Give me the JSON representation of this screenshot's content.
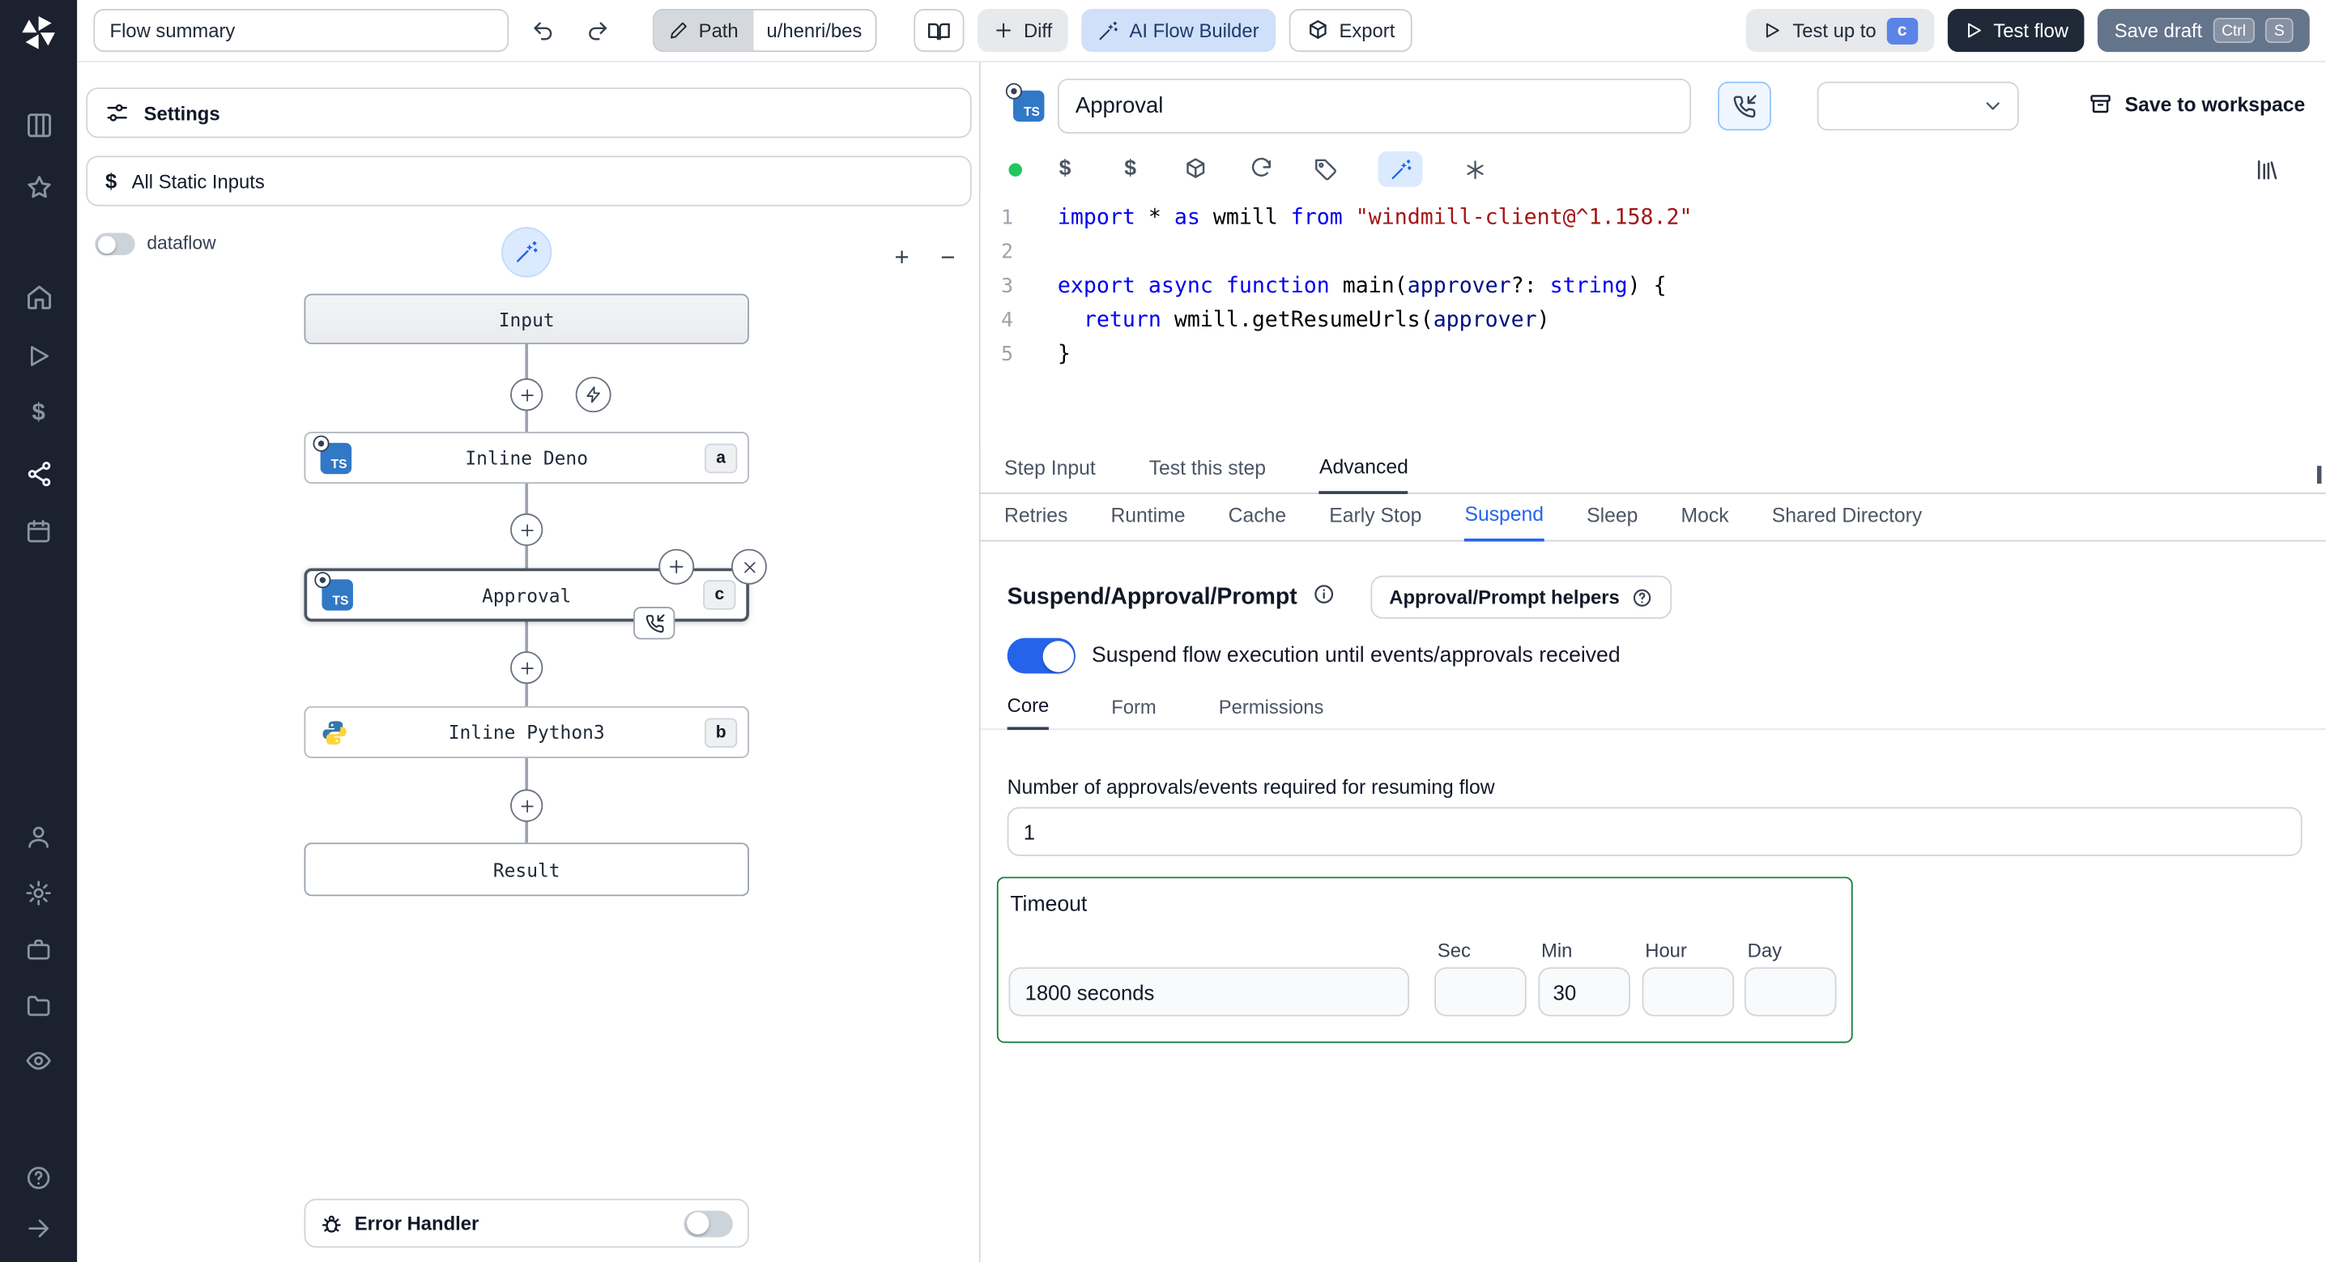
{
  "colors": {
    "accent_blue": "#2563eb",
    "light_blue": "#dbeafe",
    "dark_button": "#1f2937",
    "save_draft_button": "#64748b",
    "valid_dot_green": "#22c55e",
    "timeout_border_green": "#15803d",
    "sidebar_bg": "#1b212e",
    "ts_badge_blue": "#3178c6"
  },
  "icons": {
    "ts_label": "TS",
    "dollar_glyph": "$"
  },
  "topbar": {
    "summary_value": "Flow summary",
    "path_label": "Path",
    "path_value": "u/henri/bes",
    "diff_label": "Diff",
    "ai_builder_label": "AI Flow Builder",
    "export_label": "Export",
    "test_up_to_label": "Test up to",
    "test_up_to_badge": "c",
    "test_flow_label": "Test flow",
    "save_draft_label": "Save draft",
    "save_draft_kbd": [
      "Ctrl",
      "S"
    ]
  },
  "flow_panel": {
    "settings_label": "Settings",
    "static_inputs_label": "All Static Inputs",
    "dataflow_label": "dataflow",
    "zoom_in_label": "+",
    "zoom_out_label": "−",
    "nodes": {
      "input": {
        "label": "Input"
      },
      "deno": {
        "label": "Inline Deno",
        "badge": "a"
      },
      "approval": {
        "label": "Approval",
        "badge": "c"
      },
      "python": {
        "label": "Inline Python3",
        "badge": "b"
      },
      "result": {
        "label": "Result"
      }
    },
    "error_handler_label": "Error Handler"
  },
  "editor": {
    "step_name": "Approval",
    "save_to_workspace_label": "Save to workspace",
    "line_numbers": [
      "1",
      "2",
      "3",
      "4",
      "5"
    ],
    "code_lines": [
      [
        {
          "c": "k",
          "t": "import"
        },
        {
          "c": "p",
          "t": " * "
        },
        {
          "c": "k",
          "t": "as"
        },
        {
          "c": "p",
          "t": " wmill "
        },
        {
          "c": "k",
          "t": "from"
        },
        {
          "c": "p",
          "t": " "
        },
        {
          "c": "s",
          "t": "\"windmill-client@^1.158.2\""
        }
      ],
      [],
      [
        {
          "c": "k",
          "t": "export"
        },
        {
          "c": "p",
          "t": " "
        },
        {
          "c": "k",
          "t": "async"
        },
        {
          "c": "p",
          "t": " "
        },
        {
          "c": "k",
          "t": "function"
        },
        {
          "c": "p",
          "t": " "
        },
        {
          "c": "f",
          "t": "main"
        },
        {
          "c": "p",
          "t": "("
        },
        {
          "c": "v",
          "t": "approver"
        },
        {
          "c": "p",
          "t": "?: "
        },
        {
          "c": "k",
          "t": "string"
        },
        {
          "c": "p",
          "t": ") {"
        }
      ],
      [
        {
          "c": "p",
          "t": "  "
        },
        {
          "c": "k",
          "t": "return"
        },
        {
          "c": "p",
          "t": " wmill."
        },
        {
          "c": "f",
          "t": "getResumeUrls"
        },
        {
          "c": "p",
          "t": "("
        },
        {
          "c": "v",
          "t": "approver"
        },
        {
          "c": "p",
          "t": ")"
        }
      ],
      [
        {
          "c": "p",
          "t": "}"
        }
      ]
    ]
  },
  "tabs": {
    "main": [
      "Step Input",
      "Test this step",
      "Advanced"
    ],
    "main_active": "Advanced",
    "advanced": [
      "Retries",
      "Runtime",
      "Cache",
      "Early Stop",
      "Suspend",
      "Sleep",
      "Mock",
      "Shared Directory"
    ],
    "advanced_active": "Suspend"
  },
  "suspend": {
    "title": "Suspend/Approval/Prompt",
    "helpers_label": "Approval/Prompt helpers",
    "toggle_label": "Suspend flow execution until events/approvals received",
    "toggle_on": true,
    "tabs": [
      "Core",
      "Form",
      "Permissions"
    ],
    "tabs_active": "Core",
    "approvals_label": "Number of approvals/events required for resuming flow",
    "approvals_value": "1",
    "timeout_label": "Timeout",
    "timeout_value": "1800 seconds",
    "timeout_units": [
      {
        "label": "Sec",
        "value": ""
      },
      {
        "label": "Min",
        "value": "30"
      },
      {
        "label": "Hour",
        "value": ""
      },
      {
        "label": "Day",
        "value": ""
      }
    ]
  }
}
